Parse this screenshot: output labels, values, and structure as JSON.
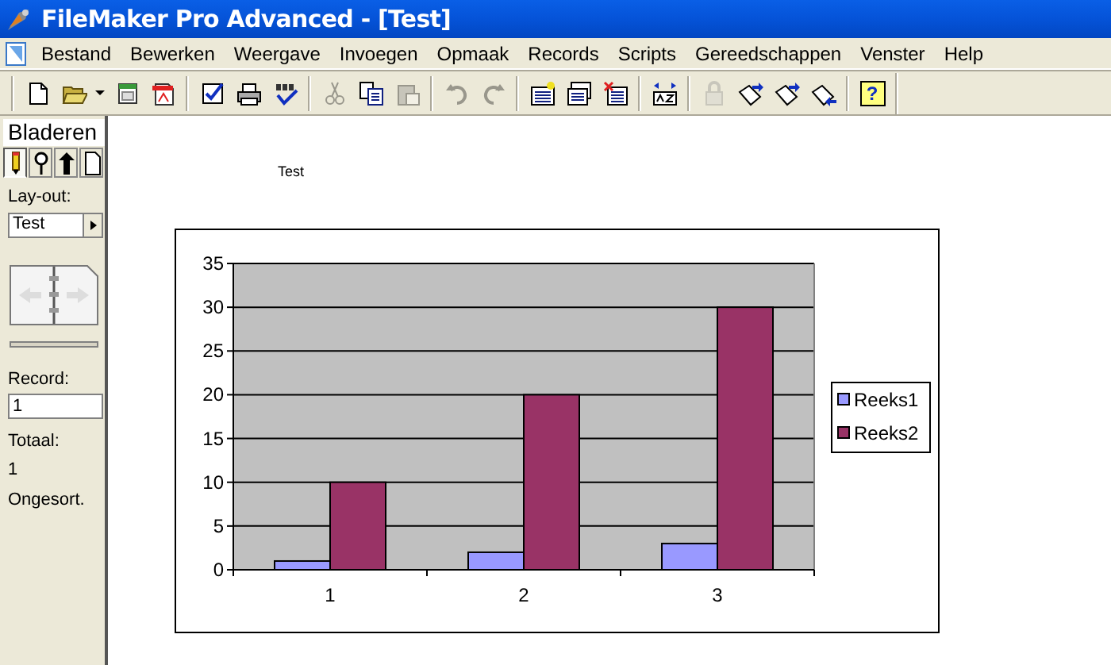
{
  "window": {
    "title": "FileMaker Pro Advanced - [Test]"
  },
  "menu": [
    "Bestand",
    "Bewerken",
    "Weergave",
    "Invoegen",
    "Opmaak",
    "Records",
    "Scripts",
    "Gereedschappen",
    "Venster",
    "Help"
  ],
  "toolbar": [
    [
      {
        "kind": "new",
        "disabled": false
      },
      {
        "kind": "open",
        "disabled": false
      },
      {
        "kind": "dropdown",
        "disabled": false
      },
      {
        "kind": "table",
        "disabled": false
      },
      {
        "kind": "pdf",
        "disabled": false
      }
    ],
    [
      {
        "kind": "check",
        "disabled": false
      },
      {
        "kind": "print",
        "disabled": false
      },
      {
        "kind": "spell",
        "disabled": false
      }
    ],
    [
      {
        "kind": "cut",
        "disabled": true
      },
      {
        "kind": "copy",
        "disabled": false
      },
      {
        "kind": "paste",
        "disabled": true
      }
    ],
    [
      {
        "kind": "undo",
        "disabled": true
      },
      {
        "kind": "redo",
        "disabled": true
      }
    ],
    [
      {
        "kind": "newrecord",
        "disabled": false
      },
      {
        "kind": "duplicate",
        "disabled": false
      },
      {
        "kind": "delete",
        "disabled": false
      }
    ],
    [
      {
        "kind": "sort",
        "disabled": false
      }
    ],
    [
      {
        "kind": "lock",
        "disabled": true
      },
      {
        "kind": "send",
        "disabled": false
      },
      {
        "kind": "send",
        "disabled": false
      },
      {
        "kind": "receive",
        "disabled": false
      }
    ],
    [
      {
        "kind": "help",
        "disabled": false,
        "glyph": "?"
      }
    ]
  ],
  "sidebar": {
    "mode_label": "Bladeren",
    "modes": [
      {
        "kind": "browse",
        "selected": true
      },
      {
        "kind": "find",
        "selected": false
      },
      {
        "kind": "layout",
        "selected": false
      },
      {
        "kind": "preview",
        "selected": false
      }
    ],
    "layout_label": "Lay-out:",
    "layout_value": "Test",
    "record_slider": {
      "level": 1
    },
    "record_label": "Record:",
    "record_value": "1",
    "total_label": "Totaal:",
    "total_value": "1",
    "sort_status": "Ongesort."
  },
  "content": {
    "label": "Test",
    "chart_data": {
      "type": "bar",
      "categories": [
        "1",
        "2",
        "3"
      ],
      "series": [
        {
          "name": "Reeks1",
          "color": "#9999ff",
          "values": [
            1,
            2,
            3
          ]
        },
        {
          "name": "Reeks2",
          "color": "#993366",
          "values": [
            10,
            20,
            30
          ]
        }
      ],
      "grid": true,
      "legend": true,
      "ylim": [
        0,
        35
      ],
      "yticks": [
        0,
        5,
        10,
        15,
        20,
        25,
        30,
        35
      ]
    }
  }
}
